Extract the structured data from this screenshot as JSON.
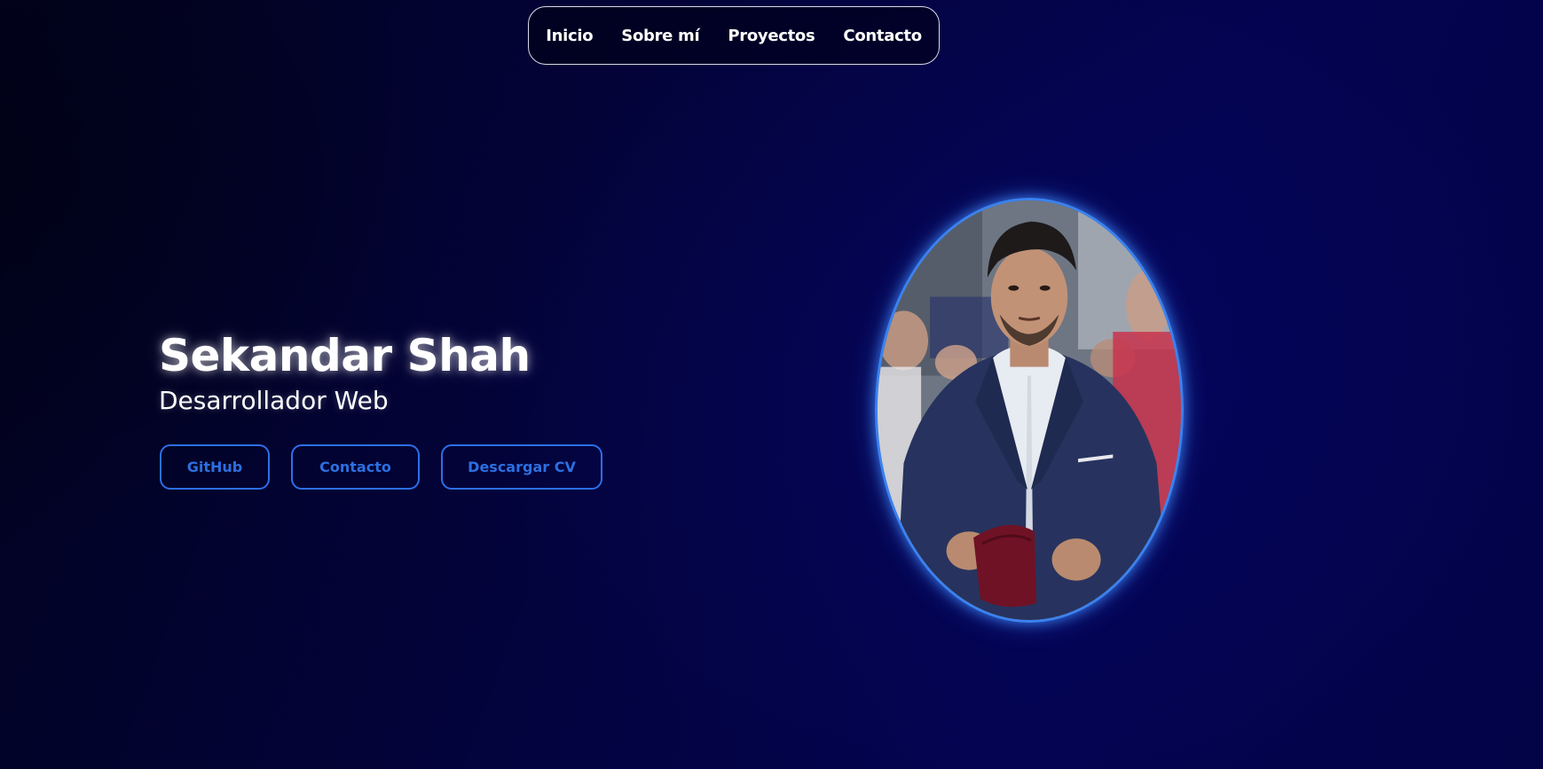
{
  "nav": {
    "items": [
      {
        "label": "Inicio"
      },
      {
        "label": "Sobre mí"
      },
      {
        "label": "Proyectos"
      },
      {
        "label": "Contacto"
      }
    ]
  },
  "hero": {
    "name": "Sekandar Shah",
    "role": "Desarrollador Web"
  },
  "buttons": {
    "github": "GitHub",
    "contact": "Contacto",
    "cv": "Descargar CV"
  },
  "colors": {
    "accent": "#2d6ee8",
    "background": "#030340",
    "text": "#ffffff"
  }
}
